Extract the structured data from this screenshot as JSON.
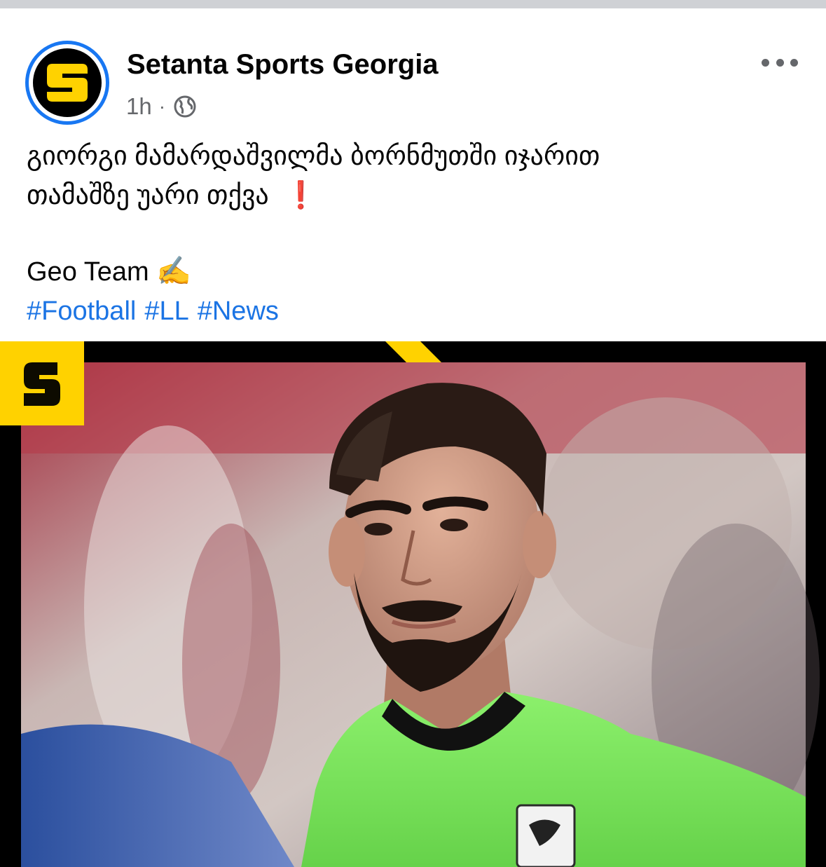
{
  "post": {
    "page_name": "Setanta Sports Georgia",
    "time": "1h",
    "separator": "·",
    "audience_icon": "globe-icon",
    "more_icon": "more-horizontal-icon",
    "text_line1": "გიორგი მამარდაშვილმა ბორნმუთში იჯარით",
    "text_line2": "თამაშზე უარი თქვა",
    "emphasis": "❗",
    "author": "Geo Team",
    "author_emoji": "✍️",
    "hashtags": [
      "#Football",
      "#LL",
      "#News"
    ]
  },
  "colors": {
    "brand_yellow": "#ffd200",
    "link_blue": "#1b74e4",
    "avatar_ring": "#1877f2",
    "meta_gray": "#65676b",
    "jersey_green": "#7ee35e"
  }
}
